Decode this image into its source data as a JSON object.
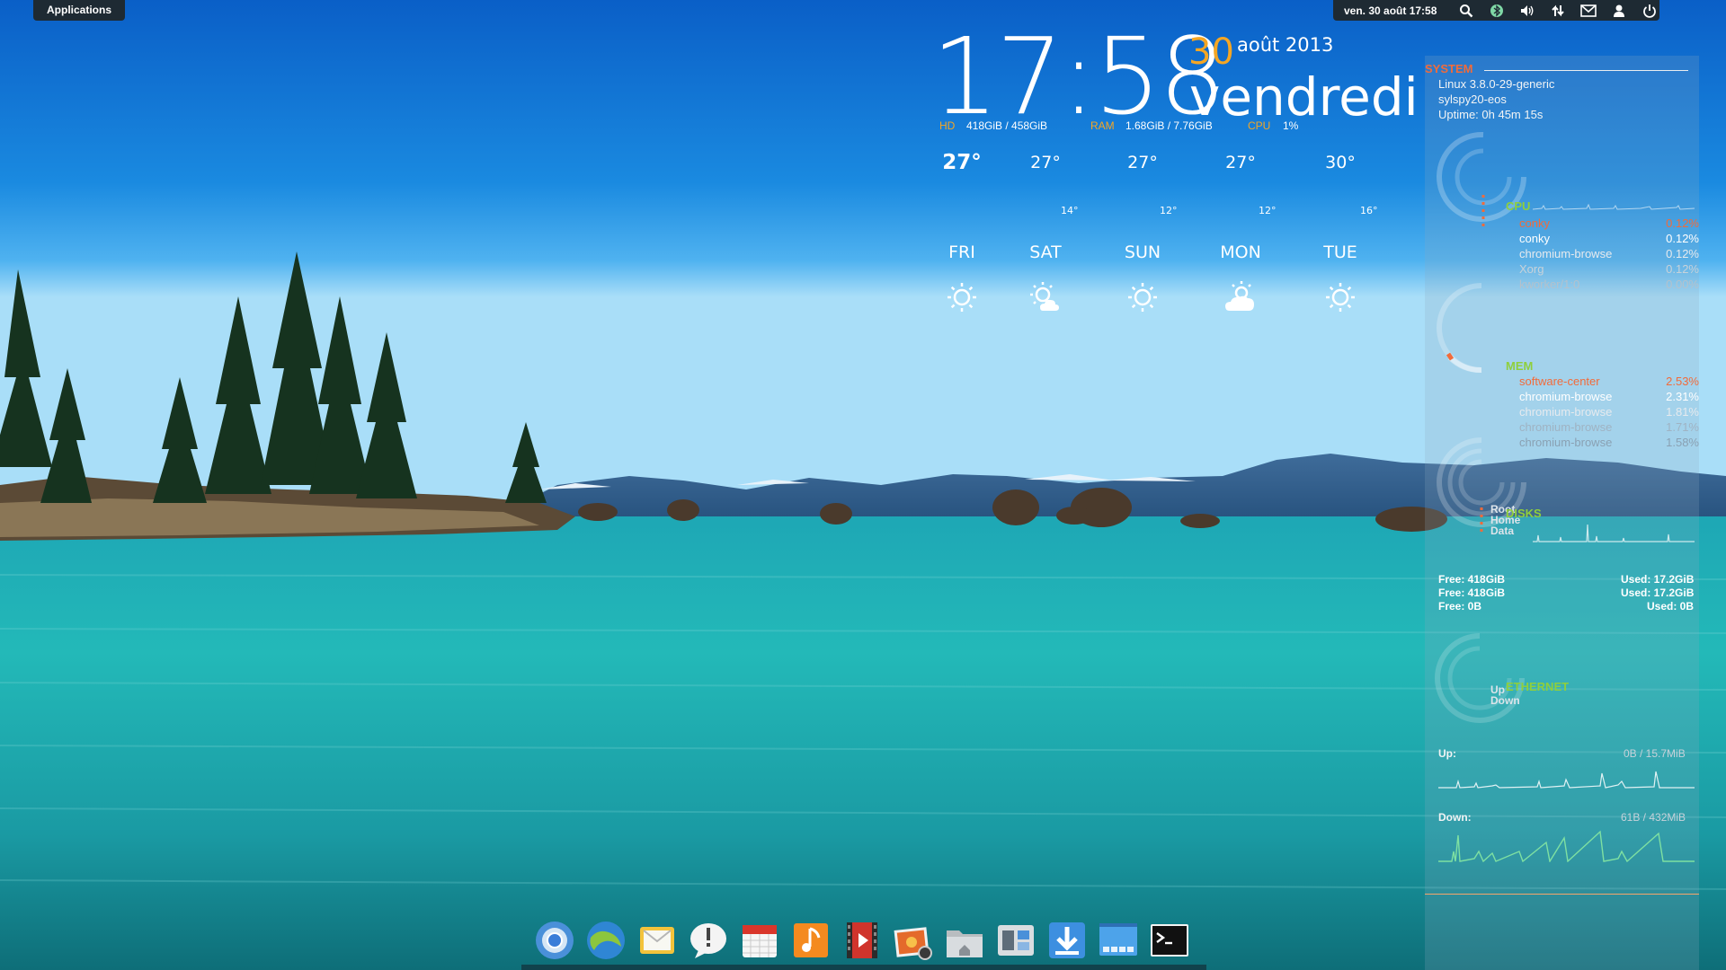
{
  "panel": {
    "applications_label": "Applications",
    "datetime": "ven. 30 août 17:58",
    "indicators": [
      "search-icon",
      "bluetooth-icon",
      "volume-icon",
      "network-icon",
      "mail-icon",
      "user-icon",
      "power-icon"
    ]
  },
  "clock": {
    "time": "17:58",
    "day": "30",
    "month_year": "août 2013",
    "weekday": "vendredi",
    "accent_color": "#f5a623"
  },
  "stats": {
    "hd_label": "HD",
    "hd_value": "418GiB  / 458GiB",
    "ram_label": "RAM",
    "ram_value": "1.68GiB / 7.76GiB",
    "cpu_label": "CPU",
    "cpu_value": "1%"
  },
  "weather": [
    {
      "name": "FRI",
      "high": "27°",
      "low": "",
      "icon": "sun-icon"
    },
    {
      "name": "SAT",
      "high": "27°",
      "low": "14°",
      "icon": "partly-cloudy-icon"
    },
    {
      "name": "SUN",
      "high": "27°",
      "low": "12°",
      "icon": "sun-icon"
    },
    {
      "name": "MON",
      "high": "27°",
      "low": "12°",
      "icon": "cloudy-sun-icon"
    },
    {
      "name": "TUE",
      "high": "30°",
      "low": "16°",
      "icon": "sun-icon"
    }
  ],
  "conky": {
    "system_title": "SYSTEM",
    "kernel": "Linux 3.8.0-29-generic",
    "hostname": "sylspy20-eos",
    "uptime": "Uptime: 0h 45m 15s",
    "cpu_title": "CPU",
    "cpu_procs": [
      {
        "name": "conky",
        "value": "0.12%"
      },
      {
        "name": "conky",
        "value": "0.12%"
      },
      {
        "name": "chromium-browse",
        "value": "0.12%"
      },
      {
        "name": "Xorg",
        "value": "0.12%"
      },
      {
        "name": "kworker/1:0",
        "value": "0.00%"
      }
    ],
    "mem_title": "MEM",
    "mem_procs": [
      {
        "name": "software-center",
        "value": "2.53%"
      },
      {
        "name": "chromium-browse",
        "value": "2.31%"
      },
      {
        "name": "chromium-browse",
        "value": "1.81%"
      },
      {
        "name": "chromium-browse",
        "value": "1.71%"
      },
      {
        "name": "chromium-browse",
        "value": "1.58%"
      }
    ],
    "disks_title": "DISKS",
    "disk_labels": [
      "Root",
      "Home",
      "Data"
    ],
    "disks": [
      {
        "free": "Free: 418GiB",
        "used": "Used: 17.2GiB"
      },
      {
        "free": "Free: 418GiB",
        "used": "Used: 17.2GiB"
      },
      {
        "free": "Free: 0B",
        "used": "Used: 0B"
      }
    ],
    "ethernet_title": "ETHERNET",
    "net_labels": [
      "Up",
      "Down"
    ],
    "up_label": "Up:",
    "up_value": "0B / 15.7MiB",
    "down_label": "Down:",
    "down_value": "61B / 432MiB",
    "section_color": "#8fcf3c",
    "system_color": "#f26b3a",
    "highlight_color": "#f26b3a"
  },
  "dock": {
    "items": [
      "chromium-icon",
      "midori-icon",
      "mail-icon",
      "chat-icon",
      "calendar-icon",
      "music-icon",
      "video-icon",
      "photos-icon",
      "files-icon",
      "switchboard-icon",
      "software-center-icon",
      "workspaces-icon",
      "terminal-icon"
    ]
  }
}
